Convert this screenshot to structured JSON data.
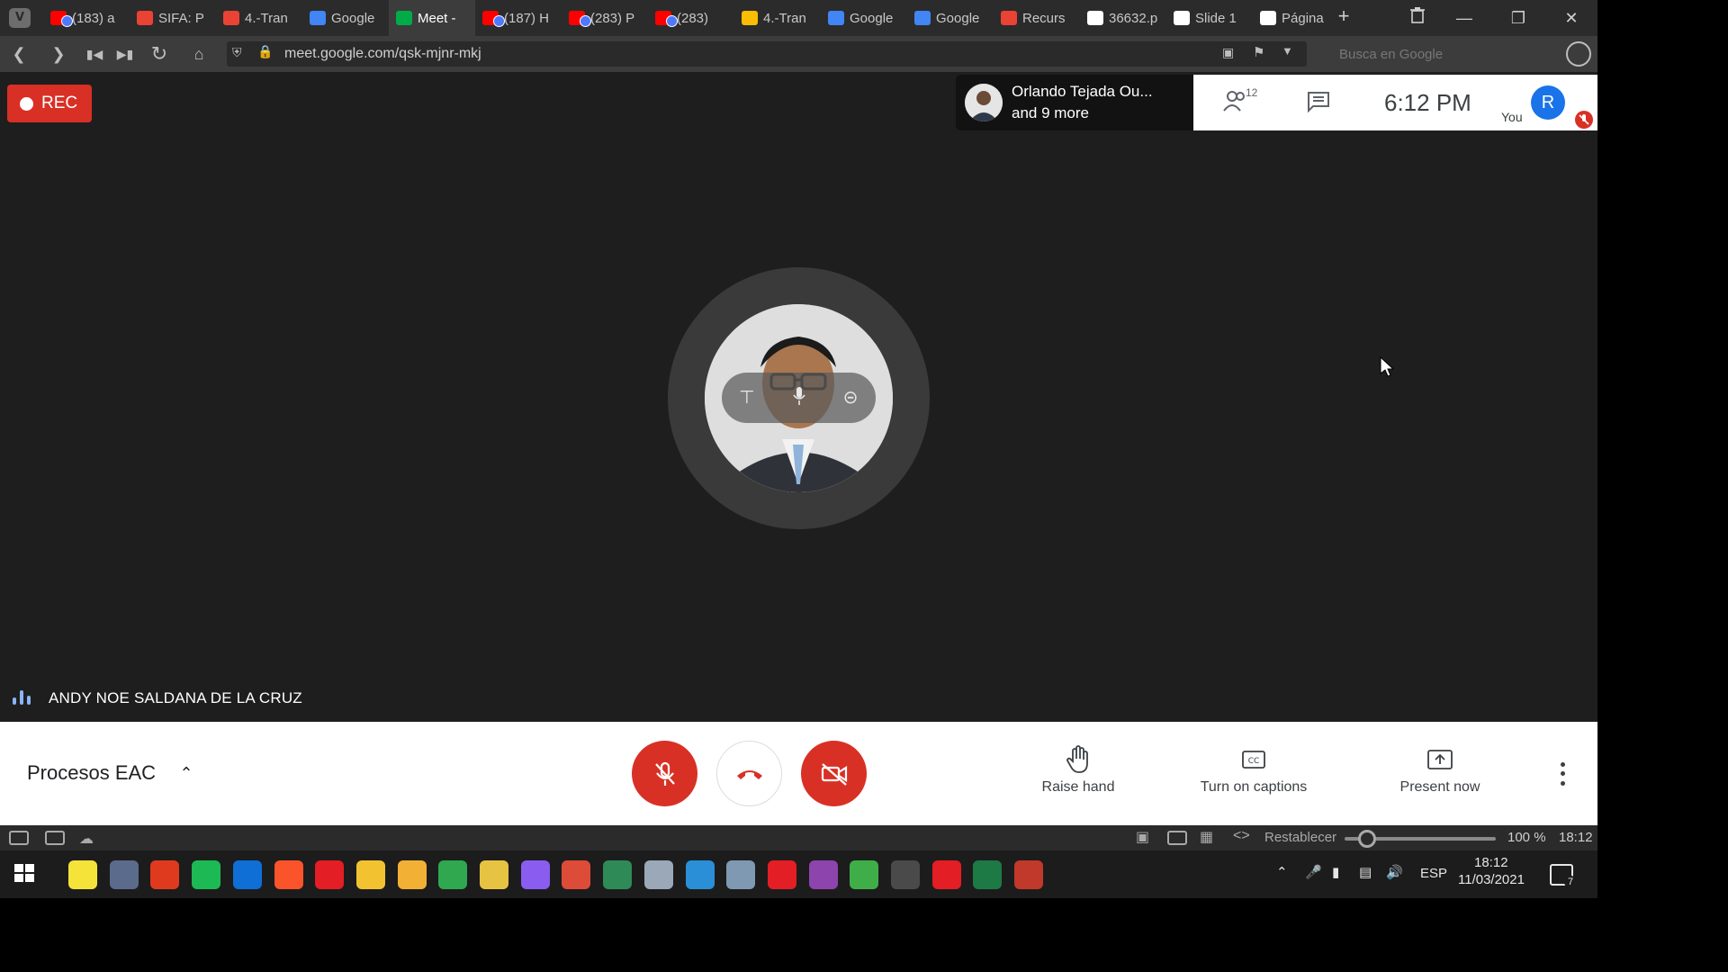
{
  "browser": {
    "tabs": [
      {
        "label": "(183) a",
        "favicon": "youtube-icon",
        "color": "#ff0000",
        "badge": true
      },
      {
        "label": "SIFA: P",
        "favicon": "gmail-icon",
        "color": "#ea4335",
        "badge": false
      },
      {
        "label": "4.-Tran",
        "favicon": "gmail-icon",
        "color": "#ea4335",
        "badge": false
      },
      {
        "label": "Google",
        "favicon": "calendar-icon",
        "color": "#4285f4",
        "badge": false
      },
      {
        "label": "Meet -",
        "favicon": "meet-icon",
        "color": "#00ac47",
        "badge": false,
        "active": true
      },
      {
        "label": "(187) H",
        "favicon": "youtube-icon",
        "color": "#ff0000",
        "badge": true
      },
      {
        "label": "(283) P",
        "favicon": "youtube-icon",
        "color": "#ff0000",
        "badge": true
      },
      {
        "label": "(283)",
        "favicon": "youtube-icon",
        "color": "#ff0000",
        "badge": true
      },
      {
        "label": "4.-Tran",
        "favicon": "drive-icon",
        "color": "#fbbc04",
        "badge": false
      },
      {
        "label": "Google",
        "favicon": "cloud-icon",
        "color": "#4285f4",
        "badge": false
      },
      {
        "label": "Google",
        "favicon": "cloud-icon",
        "color": "#4285f4",
        "badge": false
      },
      {
        "label": "Recurs",
        "favicon": "cloud-icon",
        "color": "#ea4335",
        "badge": false
      },
      {
        "label": "36632.p",
        "favicon": "document-icon",
        "color": "#ffffff",
        "badge": false
      },
      {
        "label": "Slide 1",
        "favicon": "document-icon",
        "color": "#ffffff",
        "badge": false
      },
      {
        "label": "Página",
        "favicon": "grid-icon",
        "color": "#ffffff",
        "badge": false
      }
    ],
    "url": "meet.google.com/qsk-mjnr-mkj",
    "search_placeholder": "Busca en Google"
  },
  "meet": {
    "rec_label": "REC",
    "presenter": {
      "line1": "Orlando Tejada Ou...",
      "line2": "and 9 more"
    },
    "participants_count": "12",
    "clock": "6:12 PM",
    "you_label": "You",
    "you_initial": "R",
    "speaker_name": "ANDY NOE SALDANA DE LA CRUZ",
    "meeting_title": "Procesos EAC",
    "actions": {
      "raise_hand": "Raise hand",
      "captions": "Turn on captions",
      "present": "Present now"
    },
    "colors": {
      "danger": "#d93025",
      "accent": "#1a73e8",
      "speaker": "#8ab4f8"
    }
  },
  "statusbar": {
    "reset_label": "Restablecer",
    "zoom": "100 %",
    "zoom_fraction": 0.15,
    "time": "18:12"
  },
  "taskbar": {
    "language": "ESP",
    "time": "18:12",
    "date": "11/03/2021",
    "notifications": "7"
  }
}
